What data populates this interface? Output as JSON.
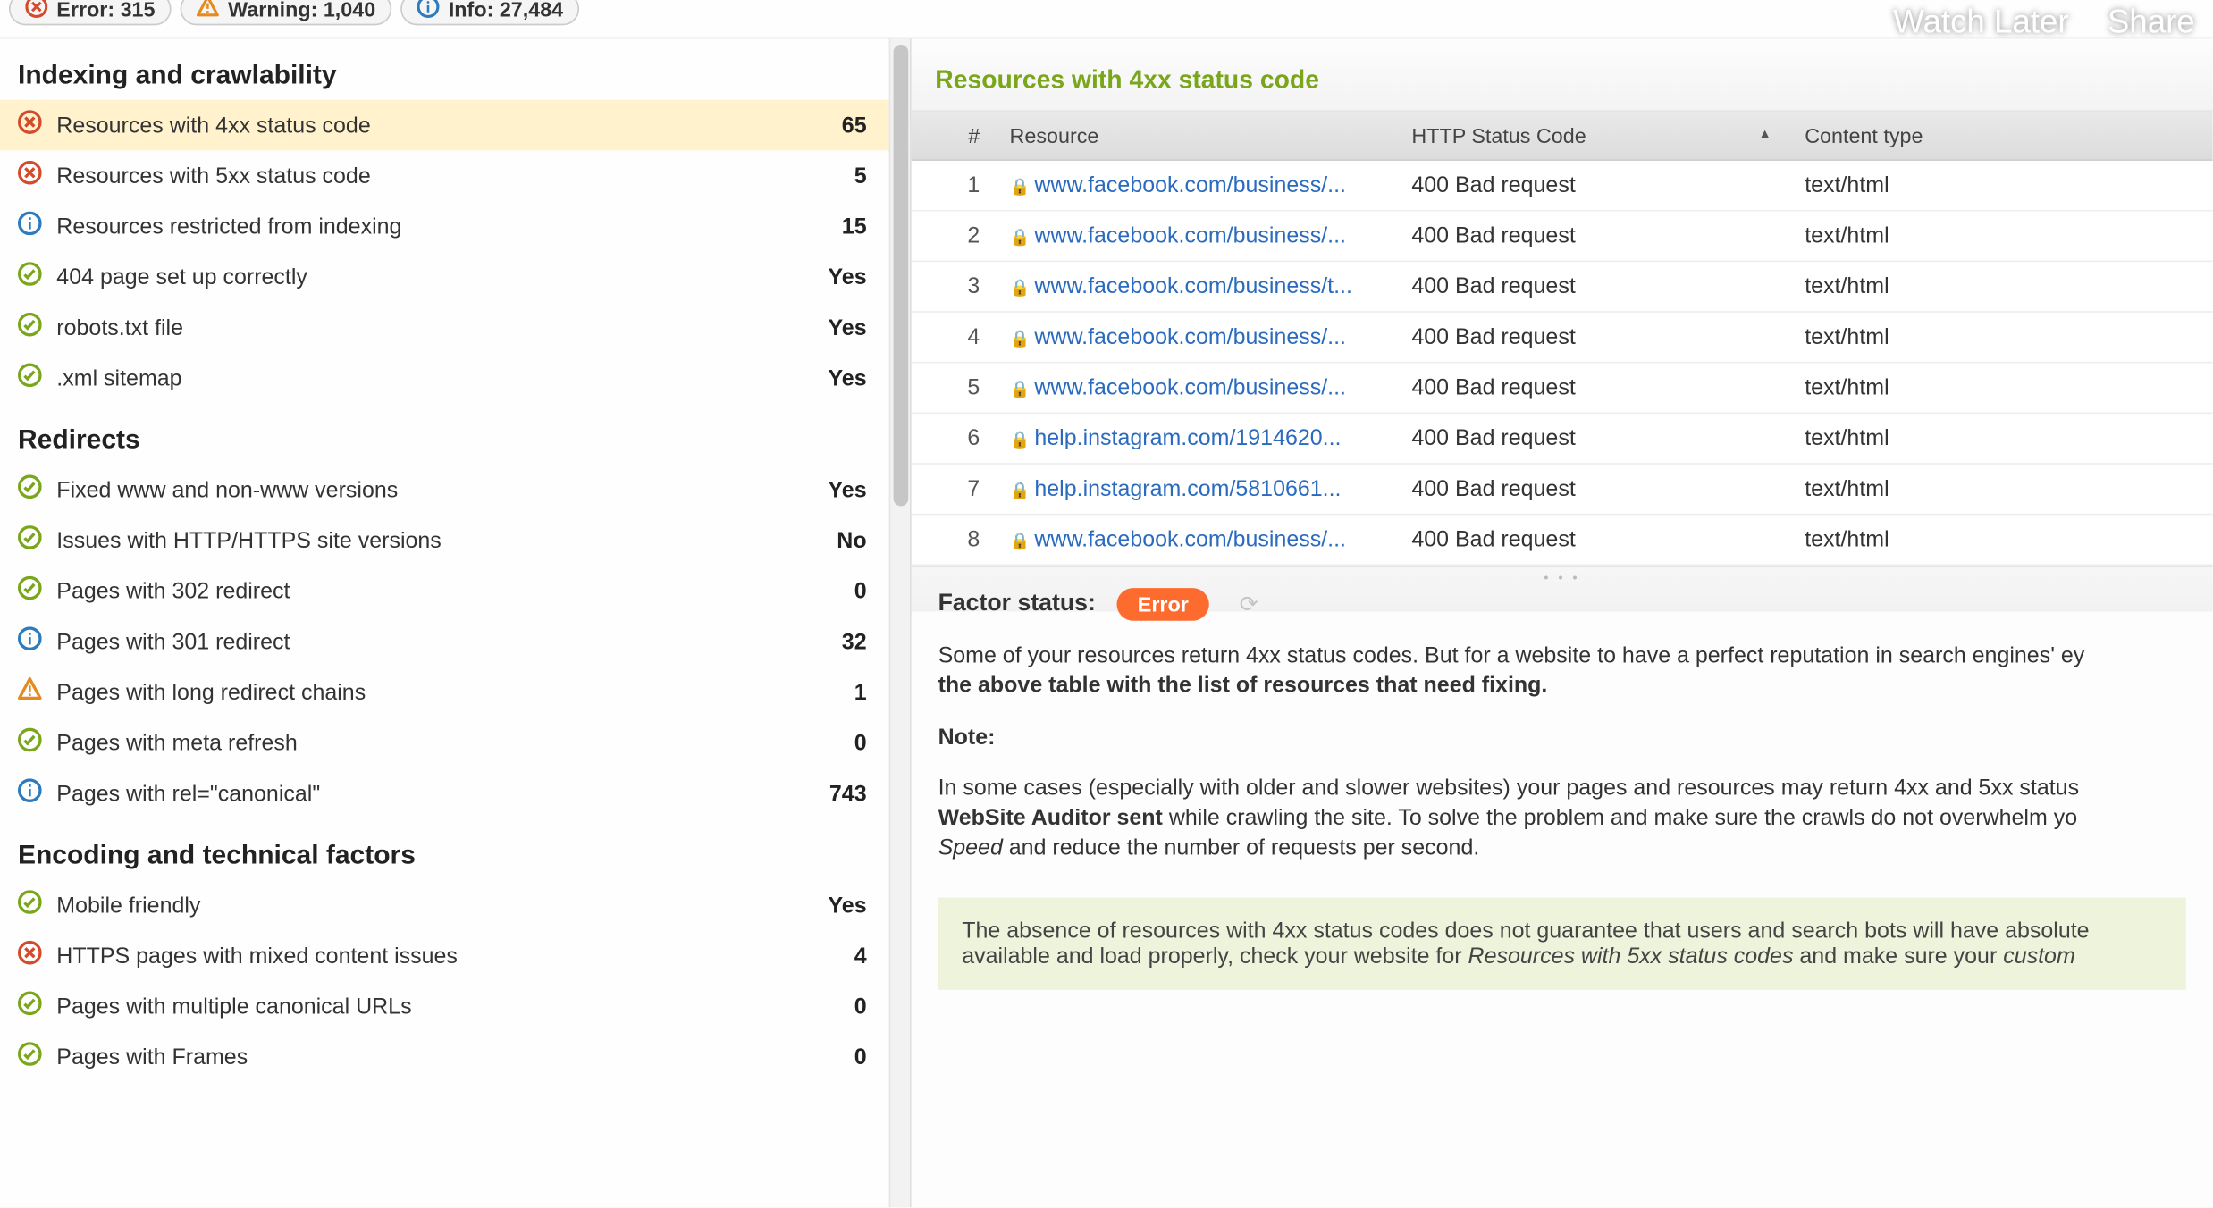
{
  "status_bar": {
    "error_label": "Error: 315",
    "warning_label": "Warning: 1,040",
    "info_label": "Info: 27,484"
  },
  "yt": {
    "watch_later": "Watch Later",
    "share": "Share"
  },
  "sidebar": {
    "sections": [
      {
        "title": "Indexing and crawlability",
        "rows": [
          {
            "icon": "error",
            "label": "Resources with 4xx status code",
            "value": "65",
            "selected": true
          },
          {
            "icon": "error",
            "label": "Resources with 5xx status code",
            "value": "5"
          },
          {
            "icon": "info",
            "label": "Resources restricted from indexing",
            "value": "15"
          },
          {
            "icon": "ok",
            "label": "404 page set up correctly",
            "value": "Yes"
          },
          {
            "icon": "ok",
            "label": "robots.txt file",
            "value": "Yes"
          },
          {
            "icon": "ok",
            "label": ".xml sitemap",
            "value": "Yes"
          }
        ]
      },
      {
        "title": "Redirects",
        "rows": [
          {
            "icon": "ok",
            "label": "Fixed www and non-www versions",
            "value": "Yes"
          },
          {
            "icon": "ok",
            "label": "Issues with HTTP/HTTPS site versions",
            "value": "No"
          },
          {
            "icon": "ok",
            "label": "Pages with 302 redirect",
            "value": "0"
          },
          {
            "icon": "info",
            "label": "Pages with 301 redirect",
            "value": "32"
          },
          {
            "icon": "warning",
            "label": "Pages with long redirect chains",
            "value": "1"
          },
          {
            "icon": "ok",
            "label": "Pages with meta refresh",
            "value": "0"
          },
          {
            "icon": "info",
            "label": "Pages with rel=\"canonical\"",
            "value": "743"
          }
        ]
      },
      {
        "title": "Encoding and technical factors",
        "rows": [
          {
            "icon": "ok",
            "label": "Mobile friendly",
            "value": "Yes"
          },
          {
            "icon": "error",
            "label": "HTTPS pages with mixed content issues",
            "value": "4"
          },
          {
            "icon": "ok",
            "label": "Pages with multiple canonical URLs",
            "value": "0"
          },
          {
            "icon": "ok",
            "label": "Pages with Frames",
            "value": "0"
          }
        ]
      }
    ]
  },
  "panel": {
    "title": "Resources with 4xx status code",
    "columns": {
      "n": "#",
      "resource": "Resource",
      "status": "HTTP Status Code",
      "content_type": "Content type"
    },
    "rows": [
      {
        "n": "1",
        "url": "www.facebook.com/business/...",
        "status": "400 Bad request",
        "ct": "text/html"
      },
      {
        "n": "2",
        "url": "www.facebook.com/business/...",
        "status": "400 Bad request",
        "ct": "text/html"
      },
      {
        "n": "3",
        "url": "www.facebook.com/business/t...",
        "status": "400 Bad request",
        "ct": "text/html"
      },
      {
        "n": "4",
        "url": "www.facebook.com/business/...",
        "status": "400 Bad request",
        "ct": "text/html"
      },
      {
        "n": "5",
        "url": "www.facebook.com/business/...",
        "status": "400 Bad request",
        "ct": "text/html"
      },
      {
        "n": "6",
        "url": "help.instagram.com/1914620...",
        "status": "400 Bad request",
        "ct": "text/html"
      },
      {
        "n": "7",
        "url": "help.instagram.com/5810661...",
        "status": "400 Bad request",
        "ct": "text/html"
      },
      {
        "n": "8",
        "url": "www.facebook.com/business/...",
        "status": "400 Bad request",
        "ct": "text/html"
      }
    ]
  },
  "detail": {
    "factor_status_label": "Factor status:",
    "status_badge": "Error",
    "p1a": "Some of your resources return 4xx status codes. But for a website to have a perfect reputation in search engines' ey",
    "p1b": "the above table with the list of resources that need fixing.",
    "note_label": "Note:",
    "p2a": "In some cases (especially with older and slower websites) your pages and resources may return 4xx and 5xx status",
    "p2b_strong": "WebSite Auditor sent",
    "p2b_rest": " while crawling the site. To solve the problem and make sure the crawls do not overwhelm yo",
    "p2c_em": "Speed",
    "p2c_rest": " and reduce the number of requests per second.",
    "callout_a": "The absence of resources with 4xx status codes does not guarantee that users and search bots will have absolute",
    "callout_b_pre": "available and load properly, check your website for ",
    "callout_b_em": "Resources with 5xx status codes",
    "callout_b_post": " and make sure your ",
    "callout_b_em2": "custom "
  }
}
